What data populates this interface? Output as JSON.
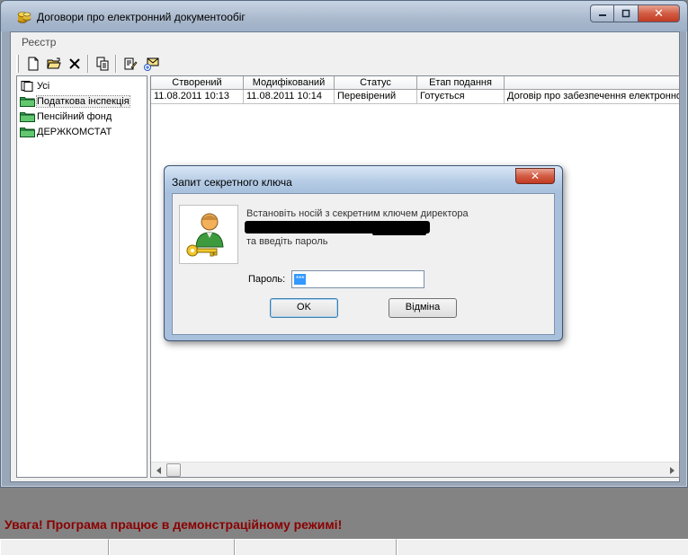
{
  "window": {
    "title": "Договори про  електронний документообіг"
  },
  "menu": {
    "items": [
      "Реєстр"
    ]
  },
  "toolbar": {
    "buttons": [
      "new-document-icon",
      "open-folder-icon",
      "delete-icon",
      "copy-document-icon",
      "edit-document-icon",
      "send-mail-icon"
    ]
  },
  "tree": {
    "items": [
      {
        "label": "Усі",
        "icon": "documents-icon",
        "selected": false
      },
      {
        "label": "Податкова інспекція",
        "icon": "folder-icon",
        "selected": true
      },
      {
        "label": "Пенсійний фонд",
        "icon": "folder-icon",
        "selected": false
      },
      {
        "label": "ДЕРЖКОМСТАТ",
        "icon": "folder-icon",
        "selected": false
      }
    ]
  },
  "grid": {
    "columns": [
      "Створений",
      "Модифікований",
      "Статус",
      "Етап подання",
      ""
    ],
    "rows": [
      [
        "11.08.2011 10:13",
        "11.08.2011 10:14",
        "Перевірений",
        "Готується",
        "Договір про забезпечення електронного"
      ]
    ]
  },
  "dialog": {
    "title": "Запит секретного ключа",
    "message_line1": "Встановіть носій з секретним ключем директора",
    "message_line2": "та введіть пароль",
    "password_label": "Пароль:",
    "password_value": "***",
    "ok_label": "OK",
    "cancel_label": "Відміна",
    "close_symbol": "✕"
  },
  "warning_text": "Увага! Програма працює в демонстраційному режимі!",
  "colors": {
    "warning": "#8b0000",
    "selection": "#3399ff"
  }
}
